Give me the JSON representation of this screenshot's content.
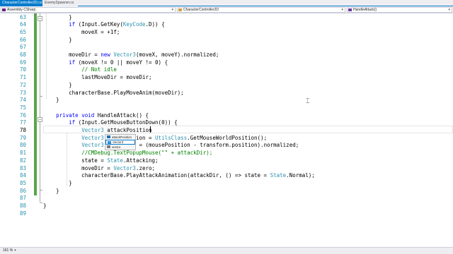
{
  "tabs": [
    {
      "label": "CharacterController2D.cs*",
      "active": true
    },
    {
      "label": "EnemySpawner.cs",
      "active": false
    }
  ],
  "nav": {
    "project": "Assembly-CSharp",
    "class": "CharacterController2D",
    "member": "HandleAttack()"
  },
  "editor": {
    "lines": [
      {
        "n": "63",
        "html": "        }"
      },
      {
        "n": "64",
        "html": "        <span class=\"kw\">if</span> (Input.GetKey(<span class=\"ty\">KeyCode</span>.D)) {"
      },
      {
        "n": "65",
        "html": "            moveX = +1f;"
      },
      {
        "n": "66",
        "html": "        }"
      },
      {
        "n": "67",
        "html": ""
      },
      {
        "n": "68",
        "html": "        moveDir = <span class=\"kw\">new</span> <span class=\"ty\">Vector3</span>(moveX, moveY).normalized;"
      },
      {
        "n": "69",
        "html": "        <span class=\"kw\">if</span> (moveX != 0 || moveY != 0) {"
      },
      {
        "n": "70",
        "html": "            <span class=\"cm\">// Not idle</span>"
      },
      {
        "n": "71",
        "html": "            lastMoveDir = moveDir;"
      },
      {
        "n": "72",
        "html": "        }"
      },
      {
        "n": "73",
        "html": "        characterBase.PlayMoveAnim(moveDir);"
      },
      {
        "n": "74",
        "html": "    }"
      },
      {
        "n": "75",
        "html": ""
      },
      {
        "n": "76",
        "html": "    <span class=\"kw\">private</span> <span class=\"kw\">void</span> HandleAttack() {"
      },
      {
        "n": "77",
        "html": "        <span class=\"kw\">if</span> (Input.GetMouseButtonDown(0)) {"
      },
      {
        "n": "78",
        "html": "            <span class=\"ty\">Vector3</span> attackPosition"
      },
      {
        "n": "79",
        "html": "            <span class=\"ty\">Vector3</span>         tion = <span class=\"ty\">UtilsClass</span>.GetMouseWorldPosition();"
      },
      {
        "n": "80",
        "html": "            <span class=\"ty\">Vector3</span>           = (mousePosition - transform.position).normalized;"
      },
      {
        "n": "81",
        "html": "            <span class=\"cm\">//CMDebug.TextPopupMouse(\"\" + attackDir);</span>"
      },
      {
        "n": "82",
        "html": "            state = <span class=\"ty\">State</span>.Attacking;"
      },
      {
        "n": "83",
        "html": "            moveDir = <span class=\"ty\">Vector3</span>.zero;"
      },
      {
        "n": "84",
        "html": "            characterBase.PlayAttackAnimation(attackDir, () => state = <span class=\"ty\">State</span>.Normal);"
      },
      {
        "n": "85",
        "html": "        }"
      },
      {
        "n": "86",
        "html": "    }"
      },
      {
        "n": "87",
        "html": ""
      },
      {
        "n": "88",
        "html": "}"
      },
      {
        "n": "89",
        "html": ""
      }
    ]
  },
  "intellisense": {
    "items": [
      {
        "label": "attackPosition",
        "selected": false
      },
      {
        "label": "Vector3",
        "selected": true
      },
      {
        "label": "vector",
        "selected": false
      }
    ]
  },
  "status": {
    "zoom": "161 %"
  },
  "colors": {
    "accent": "#007acc",
    "keyword": "#0000ff",
    "type": "#2b91af",
    "comment": "#008000",
    "change_bar": "#57a64a"
  }
}
